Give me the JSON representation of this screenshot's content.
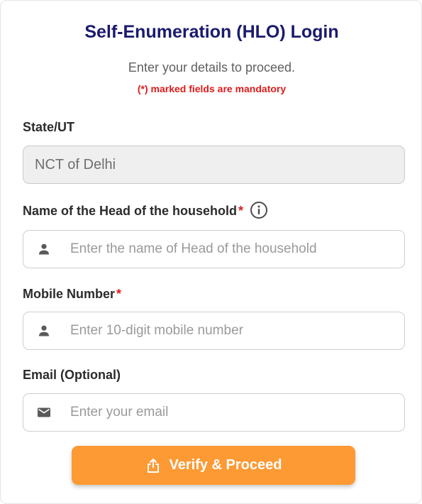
{
  "form": {
    "title": "Self-Enumeration (HLO) Login",
    "subtitle": "Enter your details to proceed.",
    "mandatory_note": "(*) marked fields are mandatory"
  },
  "fields": {
    "state": {
      "label": "State/UT",
      "value": "NCT of Delhi"
    },
    "head_name": {
      "label": "Name of the Head of the household",
      "required_mark": "*",
      "placeholder": "Enter the name of Head of the household",
      "icon": "person-icon",
      "info_icon": "info-icon"
    },
    "mobile": {
      "label": "Mobile Number",
      "required_mark": "*",
      "placeholder": "Enter 10-digit mobile number",
      "icon": "person-icon"
    },
    "email": {
      "label": "Email (Optional)",
      "placeholder": "Enter your email",
      "icon": "mail-icon"
    }
  },
  "submit": {
    "label": "Verify & Proceed",
    "icon": "share-upload-icon",
    "color": "#fd9a34"
  },
  "colors": {
    "title": "#1a1a6e",
    "mandatory": "#e01a1a",
    "accent": "#fd9a34"
  }
}
